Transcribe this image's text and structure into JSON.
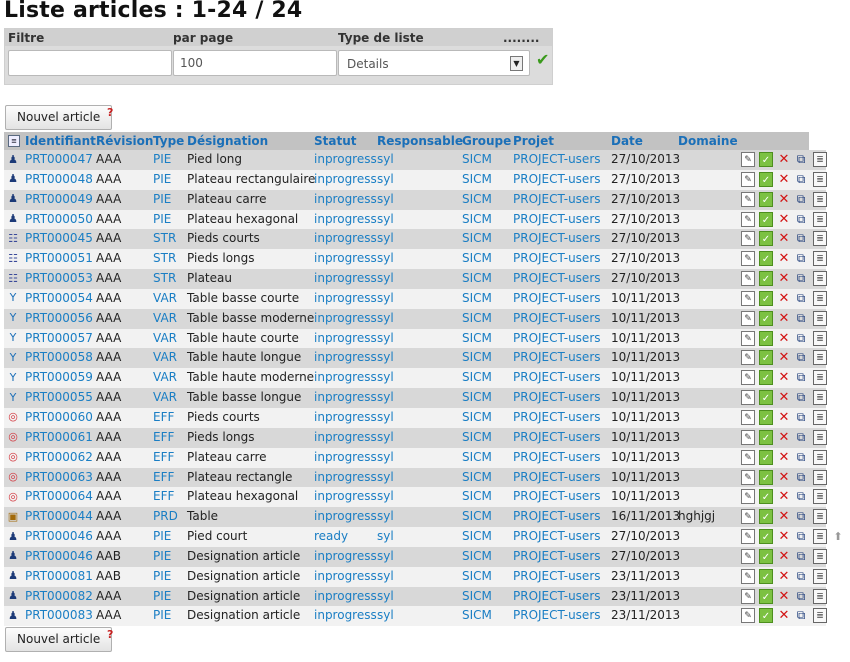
{
  "page": {
    "title": "Liste articles : 1-24 / 24"
  },
  "filters": {
    "filter_label": "Filtre",
    "per_page_label": "par page",
    "list_type_label": "Type de liste",
    "dots_label": "........",
    "filter_value": "",
    "per_page_value": "100",
    "list_type_value": "Details"
  },
  "buttons": {
    "new_article": "Nouvel article",
    "help_symbol": "?"
  },
  "table": {
    "headers": {
      "identifiant": "Identifiant",
      "revision": "Révision",
      "type": "Type",
      "designation": "Désignation",
      "statut": "Statut",
      "responsable": "Responsable",
      "groupe": "Groupe",
      "projet": "Projet",
      "date": "Date",
      "domaine": "Domaine"
    },
    "rows": [
      {
        "icon": "part-icon",
        "id": "PRT000047",
        "rev": "AAA",
        "type": "PIE",
        "designation": "Pied long",
        "statut": "inprogress",
        "resp": "syl",
        "groupe": "SICM",
        "projet": "PROJECT-users",
        "date": "27/10/2013",
        "domaine": ""
      },
      {
        "icon": "part-icon",
        "id": "PRT000048",
        "rev": "AAA",
        "type": "PIE",
        "designation": "Plateau rectangulaire",
        "statut": "inprogress",
        "resp": "syl",
        "groupe": "SICM",
        "projet": "PROJECT-users",
        "date": "27/10/2013",
        "domaine": ""
      },
      {
        "icon": "part-icon",
        "id": "PRT000049",
        "rev": "AAA",
        "type": "PIE",
        "designation": "Plateau carre",
        "statut": "inprogress",
        "resp": "syl",
        "groupe": "SICM",
        "projet": "PROJECT-users",
        "date": "27/10/2013",
        "domaine": ""
      },
      {
        "icon": "part-icon",
        "id": "PRT000050",
        "rev": "AAA",
        "type": "PIE",
        "designation": "Plateau hexagonal",
        "statut": "inprogress",
        "resp": "syl",
        "groupe": "SICM",
        "projet": "PROJECT-users",
        "date": "27/10/2013",
        "domaine": ""
      },
      {
        "icon": "structure-icon",
        "id": "PRT000045",
        "rev": "AAA",
        "type": "STR",
        "designation": "Pieds courts",
        "statut": "inprogress",
        "resp": "syl",
        "groupe": "SICM",
        "projet": "PROJECT-users",
        "date": "27/10/2013",
        "domaine": ""
      },
      {
        "icon": "structure-icon",
        "id": "PRT000051",
        "rev": "AAA",
        "type": "STR",
        "designation": "Pieds longs",
        "statut": "inprogress",
        "resp": "syl",
        "groupe": "SICM",
        "projet": "PROJECT-users",
        "date": "27/10/2013",
        "domaine": ""
      },
      {
        "icon": "structure-icon",
        "id": "PRT000053",
        "rev": "AAA",
        "type": "STR",
        "designation": "Plateau",
        "statut": "inprogress",
        "resp": "syl",
        "groupe": "SICM",
        "projet": "PROJECT-users",
        "date": "27/10/2013",
        "domaine": ""
      },
      {
        "icon": "variant-icon",
        "id": "PRT000054",
        "rev": "AAA",
        "type": "VAR",
        "designation": "Table basse courte",
        "statut": "inprogress",
        "resp": "syl",
        "groupe": "SICM",
        "projet": "PROJECT-users",
        "date": "10/11/2013",
        "domaine": ""
      },
      {
        "icon": "variant-icon",
        "id": "PRT000056",
        "rev": "AAA",
        "type": "VAR",
        "designation": "Table basse moderne",
        "statut": "inprogress",
        "resp": "syl",
        "groupe": "SICM",
        "projet": "PROJECT-users",
        "date": "10/11/2013",
        "domaine": ""
      },
      {
        "icon": "variant-icon",
        "id": "PRT000057",
        "rev": "AAA",
        "type": "VAR",
        "designation": "Table haute courte",
        "statut": "inprogress",
        "resp": "syl",
        "groupe": "SICM",
        "projet": "PROJECT-users",
        "date": "10/11/2013",
        "domaine": ""
      },
      {
        "icon": "variant-icon",
        "id": "PRT000058",
        "rev": "AAA",
        "type": "VAR",
        "designation": "Table haute longue",
        "statut": "inprogress",
        "resp": "syl",
        "groupe": "SICM",
        "projet": "PROJECT-users",
        "date": "10/11/2013",
        "domaine": ""
      },
      {
        "icon": "variant-icon",
        "id": "PRT000059",
        "rev": "AAA",
        "type": "VAR",
        "designation": "Table haute moderne",
        "statut": "inprogress",
        "resp": "syl",
        "groupe": "SICM",
        "projet": "PROJECT-users",
        "date": "10/11/2013",
        "domaine": ""
      },
      {
        "icon": "variant-icon",
        "id": "PRT000055",
        "rev": "AAA",
        "type": "VAR",
        "designation": "Table basse longue",
        "statut": "inprogress",
        "resp": "syl",
        "groupe": "SICM",
        "projet": "PROJECT-users",
        "date": "10/11/2013",
        "domaine": ""
      },
      {
        "icon": "target-icon",
        "id": "PRT000060",
        "rev": "AAA",
        "type": "EFF",
        "designation": "Pieds courts",
        "statut": "inprogress",
        "resp": "syl",
        "groupe": "SICM",
        "projet": "PROJECT-users",
        "date": "10/11/2013",
        "domaine": ""
      },
      {
        "icon": "target-icon",
        "id": "PRT000061",
        "rev": "AAA",
        "type": "EFF",
        "designation": "Pieds longs",
        "statut": "inprogress",
        "resp": "syl",
        "groupe": "SICM",
        "projet": "PROJECT-users",
        "date": "10/11/2013",
        "domaine": ""
      },
      {
        "icon": "target-icon",
        "id": "PRT000062",
        "rev": "AAA",
        "type": "EFF",
        "designation": "Plateau carre",
        "statut": "inprogress",
        "resp": "syl",
        "groupe": "SICM",
        "projet": "PROJECT-users",
        "date": "10/11/2013",
        "domaine": ""
      },
      {
        "icon": "target-icon",
        "id": "PRT000063",
        "rev": "AAA",
        "type": "EFF",
        "designation": "Plateau rectangle",
        "statut": "inprogress",
        "resp": "syl",
        "groupe": "SICM",
        "projet": "PROJECT-users",
        "date": "10/11/2013",
        "domaine": ""
      },
      {
        "icon": "target-icon",
        "id": "PRT000064",
        "rev": "AAA",
        "type": "EFF",
        "designation": "Plateau hexagonal",
        "statut": "inprogress",
        "resp": "syl",
        "groupe": "SICM",
        "projet": "PROJECT-users",
        "date": "10/11/2013",
        "domaine": ""
      },
      {
        "icon": "product-icon",
        "id": "PRT000044",
        "rev": "AAA",
        "type": "PRD",
        "designation": "Table",
        "statut": "inprogress",
        "resp": "syl",
        "groupe": "SICM",
        "projet": "PROJECT-users",
        "date": "16/11/2013",
        "domaine": "hghjgj"
      },
      {
        "icon": "part-icon",
        "id": "PRT000046",
        "rev": "AAA",
        "type": "PIE",
        "designation": "Pied court",
        "statut": "ready",
        "resp": "syl",
        "groupe": "SICM",
        "projet": "PROJECT-users",
        "date": "27/10/2013",
        "domaine": "",
        "up": true
      },
      {
        "icon": "part-icon",
        "id": "PRT000046",
        "rev": "AAB",
        "type": "PIE",
        "designation": "Designation article",
        "statut": "inprogress",
        "resp": "syl",
        "groupe": "SICM",
        "projet": "PROJECT-users",
        "date": "27/10/2013",
        "domaine": ""
      },
      {
        "icon": "part-icon",
        "id": "PRT000081",
        "rev": "AAB",
        "type": "PIE",
        "designation": "Designation article",
        "statut": "inprogress",
        "resp": "syl",
        "groupe": "SICM",
        "projet": "PROJECT-users",
        "date": "23/11/2013",
        "domaine": ""
      },
      {
        "icon": "part-icon",
        "id": "PRT000082",
        "rev": "AAA",
        "type": "PIE",
        "designation": "Designation article",
        "statut": "inprogress",
        "resp": "syl",
        "groupe": "SICM",
        "projet": "PROJECT-users",
        "date": "23/11/2013",
        "domaine": ""
      },
      {
        "icon": "part-icon",
        "id": "PRT000083",
        "rev": "AAA",
        "type": "PIE",
        "designation": "Designation article",
        "statut": "inprogress",
        "resp": "syl",
        "groupe": "SICM",
        "projet": "PROJECT-users",
        "date": "23/11/2013",
        "domaine": ""
      }
    ]
  },
  "colors": {
    "link": "#1a7ec4",
    "header_bg": "#c2c2c2",
    "row_odd": "#d8d8d8",
    "row_even": "#f2f2f2"
  }
}
